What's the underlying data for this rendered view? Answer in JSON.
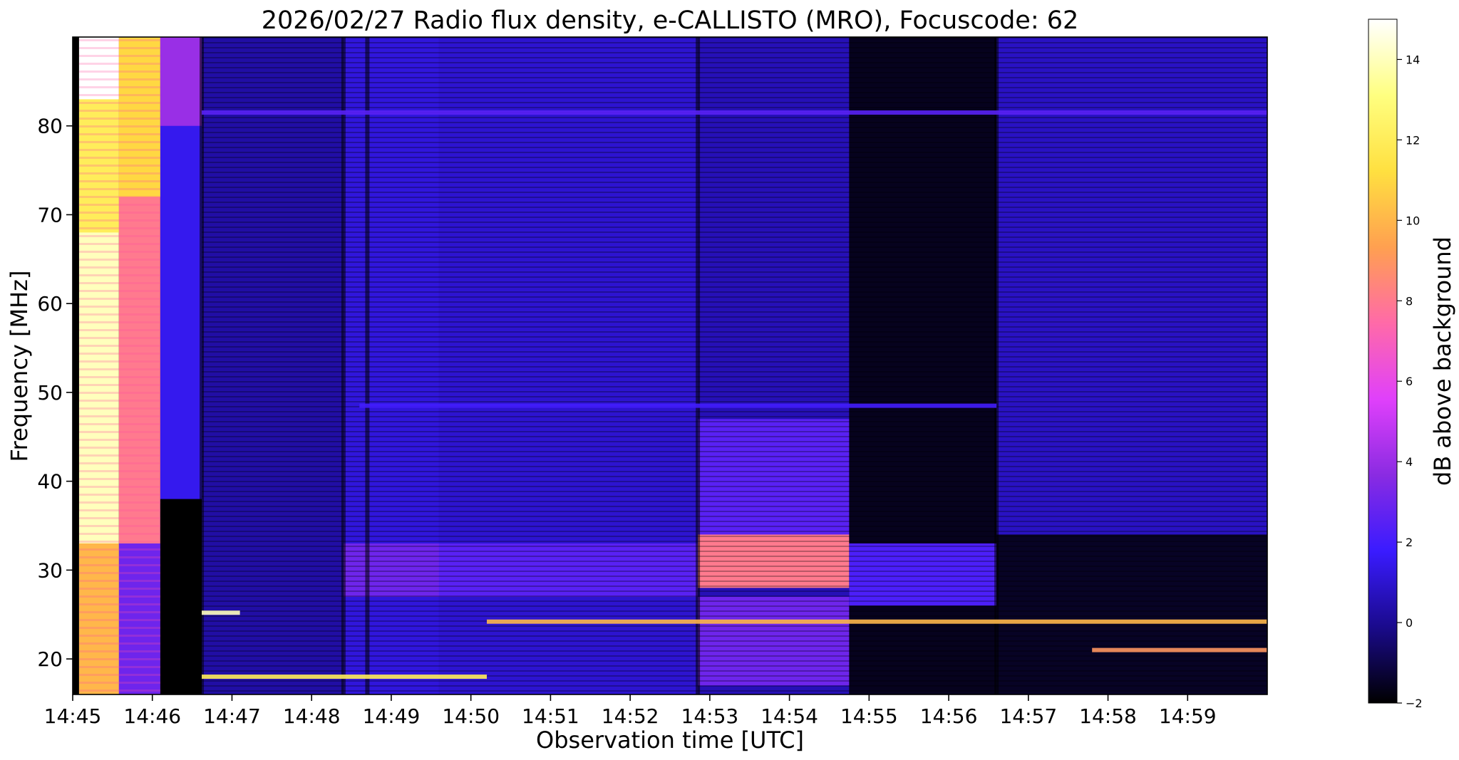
{
  "chart_data": {
    "type": "heatmap",
    "title": "2026/02/27  Radio flux density, e-CALLISTO (MRO), Focuscode: 62",
    "xlabel": "Observation time [UTC]",
    "ylabel": "Frequency [MHz]",
    "colorbar_label": "dB above background",
    "x_range": [
      "14:45",
      "15:00"
    ],
    "xlim_minutes": [
      0,
      15
    ],
    "ylim": [
      16,
      90
    ],
    "x_ticks": [
      {
        "value": 0,
        "label": "14:45"
      },
      {
        "value": 1,
        "label": "14:46"
      },
      {
        "value": 2,
        "label": "14:47"
      },
      {
        "value": 3,
        "label": "14:48"
      },
      {
        "value": 4,
        "label": "14:49"
      },
      {
        "value": 5,
        "label": "14:50"
      },
      {
        "value": 6,
        "label": "14:51"
      },
      {
        "value": 7,
        "label": "14:52"
      },
      {
        "value": 8,
        "label": "14:53"
      },
      {
        "value": 9,
        "label": "14:54"
      },
      {
        "value": 10,
        "label": "14:55"
      },
      {
        "value": 11,
        "label": "14:56"
      },
      {
        "value": 12,
        "label": "14:57"
      },
      {
        "value": 13,
        "label": "14:58"
      },
      {
        "value": 14,
        "label": "14:59"
      }
    ],
    "y_ticks": [
      20,
      30,
      40,
      50,
      60,
      70,
      80
    ],
    "colorbar_range": [
      -2,
      15
    ],
    "colorbar_ticks": [
      -2,
      0,
      2,
      4,
      6,
      8,
      10,
      12,
      14
    ],
    "colormap": [
      "#000000",
      "#1a0a8c",
      "#3a1bff",
      "#8a2be2",
      "#e040fb",
      "#ff6aa8",
      "#ffa050",
      "#ffe040",
      "#ffff80",
      "#ffffff"
    ],
    "segments": [
      {
        "t0": 0,
        "t1": 0.08,
        "level": -2
      },
      {
        "t0": 0.08,
        "t1": 0.58,
        "level": 14,
        "bands": [
          {
            "f0": 16,
            "f1": 33,
            "level": 10
          },
          {
            "f0": 68,
            "f1": 83,
            "level": 12
          },
          {
            "f0": 83,
            "f1": 90,
            "level": 15
          }
        ]
      },
      {
        "t0": 0.58,
        "t1": 1.1,
        "level": 8,
        "bands": [
          {
            "f0": 16,
            "f1": 33,
            "level": 3
          },
          {
            "f0": 72,
            "f1": 90,
            "level": 11
          }
        ]
      },
      {
        "t0": 1.1,
        "t1": 1.62,
        "level": 1.5,
        "bands": [
          {
            "f0": 16,
            "f1": 38,
            "level": -2
          },
          {
            "f0": 80,
            "f1": 90,
            "level": 4
          }
        ]
      },
      {
        "t0": 1.62,
        "t1": 3.4,
        "level": 0.3
      },
      {
        "t0": 3.4,
        "t1": 4.6,
        "level": 1.2,
        "bands": [
          {
            "f0": 27,
            "f1": 33,
            "level": 3
          }
        ]
      },
      {
        "t0": 4.6,
        "t1": 7.85,
        "level": 1.0,
        "bands": [
          {
            "f0": 27,
            "f1": 33,
            "level": 2.5
          }
        ]
      },
      {
        "t0": 7.85,
        "t1": 9.75,
        "level": 0.6,
        "bands": [
          {
            "f0": 28,
            "f1": 34,
            "level": 8
          },
          {
            "f0": 34,
            "f1": 47,
            "level": 2.5
          },
          {
            "f0": 17,
            "f1": 27,
            "level": 3
          }
        ]
      },
      {
        "t0": 9.75,
        "t1": 11.6,
        "level": -1.6,
        "bands": [
          {
            "f0": 26,
            "f1": 33,
            "level": 2.2
          }
        ]
      },
      {
        "t0": 11.6,
        "t1": 15,
        "level": 0.8,
        "bands": [
          {
            "f0": 16,
            "f1": 34,
            "level": -1.5
          }
        ]
      }
    ],
    "emission_lines": [
      {
        "freq": 24.2,
        "t0": 5.2,
        "t1": 15,
        "level": 10
      },
      {
        "freq": 25.2,
        "t0": 1.62,
        "t1": 2.1,
        "level": 14
      },
      {
        "freq": 21,
        "t0": 12.8,
        "t1": 15,
        "level": 9
      },
      {
        "freq": 18,
        "t0": 1.62,
        "t1": 5.2,
        "level": 12
      },
      {
        "freq": 48.5,
        "t0": 3.6,
        "t1": 11.6,
        "level": 2
      },
      {
        "freq": 81.5,
        "t0": 1.62,
        "t1": 15,
        "level": 2.5
      }
    ]
  }
}
